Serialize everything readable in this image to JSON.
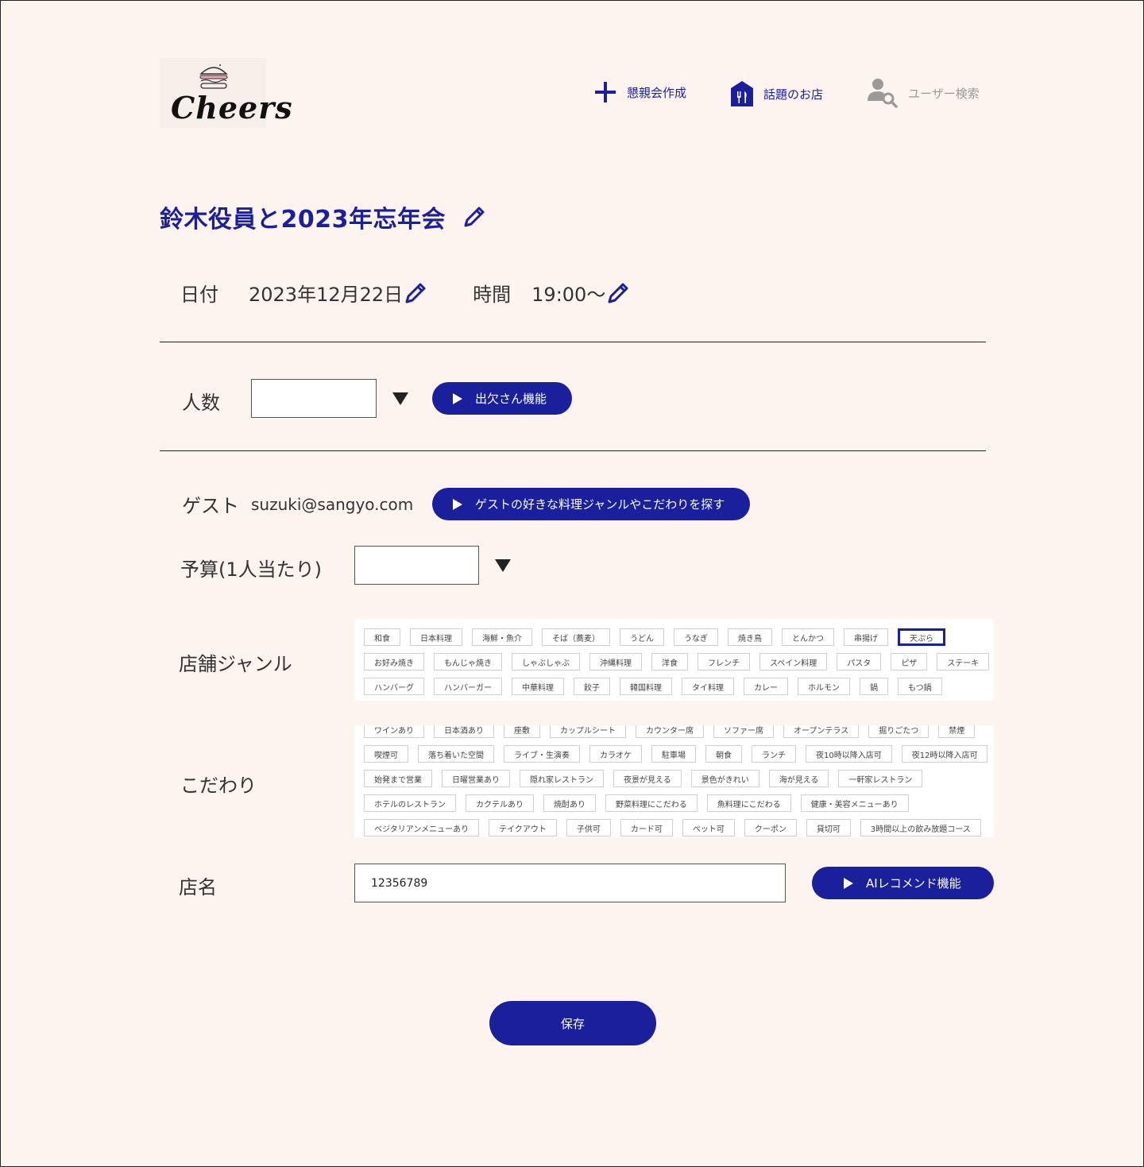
{
  "header": {
    "logo_text": "Cheers",
    "nav": {
      "create": "懇親会作成",
      "shops": "話題のお店",
      "user_search": "ユーザー検索"
    }
  },
  "event": {
    "title": "鈴木役員と2023年忘年会",
    "date_label": "日付",
    "date_value": "2023年12月22日",
    "time_label": "時間",
    "time_value": "19:00〜"
  },
  "people": {
    "label": "人数",
    "value": "",
    "attendance_button": "出欠さん機能"
  },
  "guest": {
    "label": "ゲスト",
    "email": "suzuki@sangyo.com",
    "search_button": "ゲストの好きな料理ジャンルやこだわりを探す"
  },
  "budget": {
    "label": "予算(1人当たり)",
    "value": ""
  },
  "genre": {
    "label": "店舗ジャンル",
    "rows": [
      [
        "和食",
        "日本料理",
        "海鮮・魚介",
        "そば（蕎麦）",
        "うどん",
        "うなぎ",
        "焼き鳥",
        "とんかつ",
        "串揚げ",
        "天ぷら"
      ],
      [
        "お好み焼き",
        "もんじゃ焼き",
        "しゃぶしゃぶ",
        "沖縄料理",
        "洋食",
        "フレンチ",
        "スペイン料理",
        "パスタ",
        "ピザ",
        "ステーキ"
      ],
      [
        "ハンバーグ",
        "ハンバーガー",
        "中華料理",
        "餃子",
        "韓国料理",
        "タイ料理",
        "カレー",
        "ホルモン",
        "鍋",
        "もつ鍋"
      ]
    ],
    "selected": "天ぷら"
  },
  "kodawari": {
    "label": "こだわり",
    "rows": [
      [
        "ワインあり",
        "日本酒あり",
        "座敷",
        "カップルシート",
        "カウンター席",
        "ソファー席",
        "オープンテラス",
        "掘りごたつ",
        "禁煙"
      ],
      [
        "喫煙可",
        "落ち着いた空間",
        "ライブ・生演奏",
        "カラオケ",
        "駐車場",
        "朝食",
        "ランチ",
        "夜10時以降入店可",
        "夜12時以降入店可"
      ],
      [
        "始発まで営業",
        "日曜営業あり",
        "隠れ家レストラン",
        "夜景が見える",
        "景色がきれい",
        "海が見える",
        "一軒家レストラン"
      ],
      [
        "ホテルのレストラン",
        "カクテルあり",
        "焼酎あり",
        "野菜料理にこだわる",
        "魚料理にこだわる",
        "健康・美容メニューあり"
      ],
      [
        "ベジタリアンメニューあり",
        "テイクアウト",
        "子供可",
        "カード可",
        "ペット可",
        "クーポン",
        "貸切可",
        "3時間以上の飲み放題コース"
      ]
    ]
  },
  "shop": {
    "label": "店名",
    "value": "12356789",
    "ai_button": "AIレコメンド機能"
  },
  "save_label": "保存",
  "colors": {
    "accent": "#1a1f9c",
    "background": "#fdf4f0"
  }
}
